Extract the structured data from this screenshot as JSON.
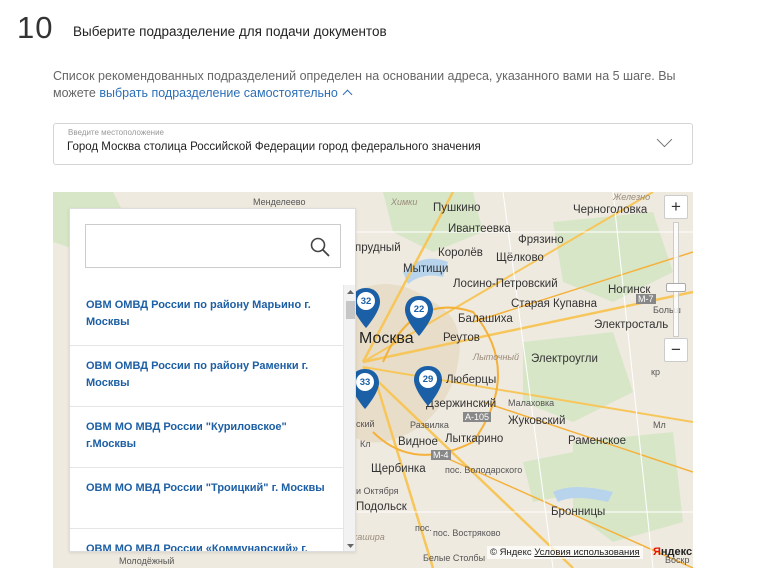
{
  "step": {
    "number": "10",
    "title": "Выберите подразделение для подачи документов"
  },
  "note": {
    "text": "Список рекомендованных подразделений определен на основании адреса, указанного вами на 5 шаге. Вы можете ",
    "link": "выбрать подразделение самостоятельно"
  },
  "location": {
    "label": "Введите местоположение",
    "value": "Город Москва столица Российской Федерации город федерального значения"
  },
  "search": {
    "placeholder": ""
  },
  "units": [
    {
      "name": "ОВМ ОМВД России по району Марьино г. Москвы"
    },
    {
      "name": "ОВМ ОМВД России по району Раменки г. Москвы"
    },
    {
      "name": "ОВМ МО МВД России \"Куриловское\" г.Москвы"
    },
    {
      "name": "ОВМ МО МВД России \"Троицкий\" г. Москвы"
    },
    {
      "name": "ОВМ МО МВД России «Коммунарский» г."
    }
  ],
  "map": {
    "places": {
      "mendeleevo": "Менделеево",
      "pushkino": "Пушкино",
      "chernogolovka": "Черноголовка",
      "ivanteevka": "Ивантеевка",
      "fryazino": "Фрязино",
      "korolev": "Королёв",
      "shchelkovo": "Щёлково",
      "prudny": "прудный",
      "mytishchi": "Мытищи",
      "losino": "Лосино-Петровский",
      "noginsk": "Ногинск",
      "staraya_kupavna": "Старая Купавна",
      "balashikha": "Балашиха",
      "elektrostal": "Электросталь",
      "moskva": "Москва",
      "reutov": "Реутов",
      "elektrougli": "Электроугли",
      "lyubertsy": "Люберцы",
      "dzerzhinsky": "Дзержинский",
      "malakhovka": "Малаховка",
      "zhukovsky": "Жуковский",
      "razvilka": "Развилка",
      "vidnoe": "Видное",
      "lytkarino": "Лыткарино",
      "ramenskoe": "Раменское",
      "shcherbinka": "Щербинка",
      "volodarsky": "пос. Володарского",
      "oktyabrya": "и Октября",
      "dolsk": "Подольск",
      "bronnitsy": "Бронницы",
      "vostryakovo": "пос. Востряково",
      "molodezhny": "Молодёжный",
      "kl": "Кл",
      "chimki": "Химки",
      "skiy": "ский",
      "kashira": "кашира",
      "zhelezno": "Железно",
      "bolsh": "Больш",
      "voskr": "Воскр",
      "ml": "Мл",
      "kr": "кр",
      "pos": "пос.",
      "ludochny": "Лыточный",
      "bely_stolby": "Белые Столбы",
      "road_m7": "М-7",
      "road_m4": "М-4",
      "road_a105": "А-105"
    },
    "markers": [
      "32",
      "22",
      "33",
      "29"
    ],
    "zoom_in": "+",
    "zoom_out": "−",
    "attribution_prefix": "© Яндекс ",
    "attribution_link": "Условия использования",
    "logo_red": "Я",
    "logo_rest": "ндекс"
  },
  "colors": {
    "link": "#2c6fb7",
    "list_text": "#1d5fa4",
    "marker": "#1b5fa6",
    "map_bg": "#efeae0"
  }
}
